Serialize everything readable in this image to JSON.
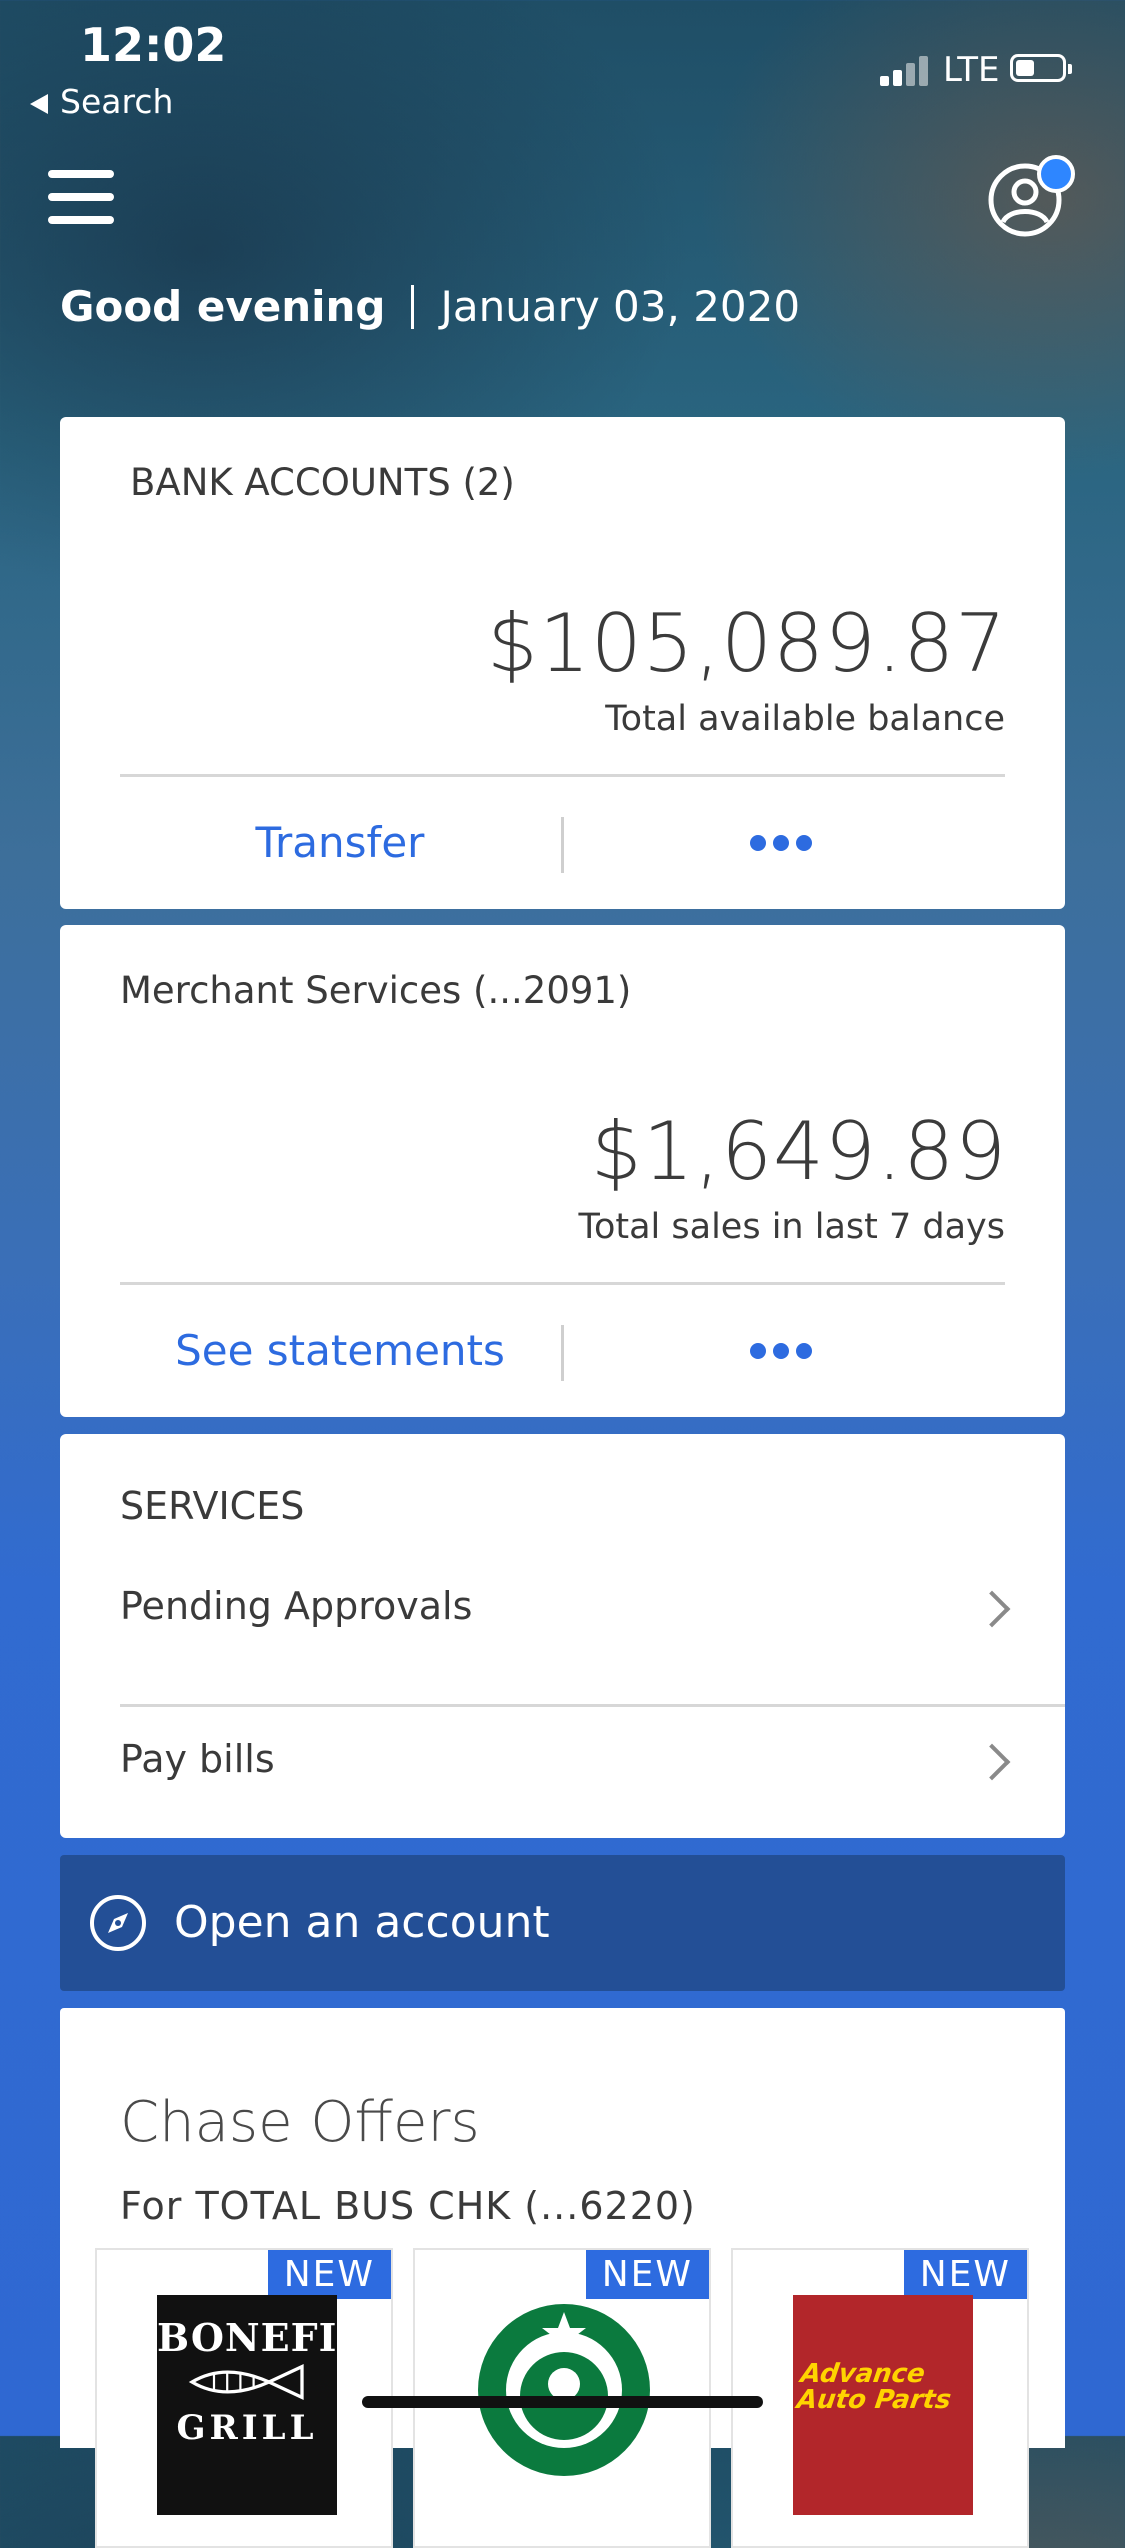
{
  "status_bar": {
    "time": "12:02",
    "back_label": "Search",
    "network": "LTE"
  },
  "header": {
    "greeting": "Good evening",
    "date": "January 03, 2020",
    "menu_icon": "hamburger-menu-icon",
    "profile_icon": "profile-icon",
    "notification_dot_color": "#2e86ff"
  },
  "bank_accounts": {
    "title": "BANK ACCOUNTS (2)",
    "amount": "$105,089.87",
    "amount_label": "Total available balance",
    "action_label": "Transfer",
    "more_icon": "more-dots-icon"
  },
  "merchant_services": {
    "title": "Merchant Services (...2091)",
    "amount": "$1,649.89",
    "amount_label": "Total sales in last 7 days",
    "action_label": "See statements",
    "more_icon": "more-dots-icon"
  },
  "services": {
    "title": "SERVICES",
    "items": [
      {
        "label": "Pending Approvals"
      },
      {
        "label": "Pay bills"
      }
    ]
  },
  "open_account": {
    "label": "Open an account",
    "icon": "compass-icon"
  },
  "offers": {
    "title": "Chase Offers",
    "subtitle": "For TOTAL BUS CHK (...6220)",
    "items": [
      {
        "badge": "NEW",
        "brand": "BONEFISH",
        "brand2": "GRILL"
      },
      {
        "badge": "NEW",
        "brand": "Starbucks"
      },
      {
        "badge": "NEW",
        "brand": "Advance",
        "brand2": "Auto Parts"
      }
    ]
  },
  "colors": {
    "accent": "#2d6be0",
    "open_account_bg": "#234f96"
  }
}
